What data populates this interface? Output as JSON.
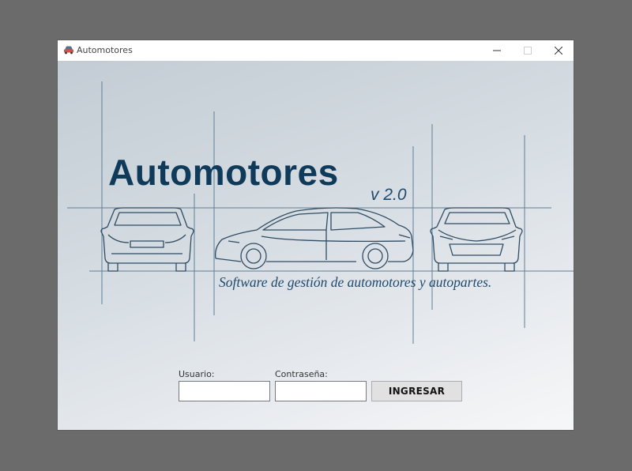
{
  "window": {
    "title": "Automotores",
    "icon": "car-icon",
    "controls": [
      "minimize-icon",
      "maximize-icon",
      "close-icon"
    ]
  },
  "banner": {
    "title": "Automotores",
    "version": "v 2.0",
    "subtitle": "Software de gestión de automotores y autopartes."
  },
  "login": {
    "username_label": "Usuario:",
    "username_value": "",
    "password_label": "Contraseña:",
    "password_value": "",
    "submit_label": "INGRESAR"
  },
  "colors": {
    "title_blue": "#0f3a5a",
    "accent_blue": "#214b6e",
    "line_blue": "#5f7f98",
    "desktop": "#6b6b6b"
  }
}
